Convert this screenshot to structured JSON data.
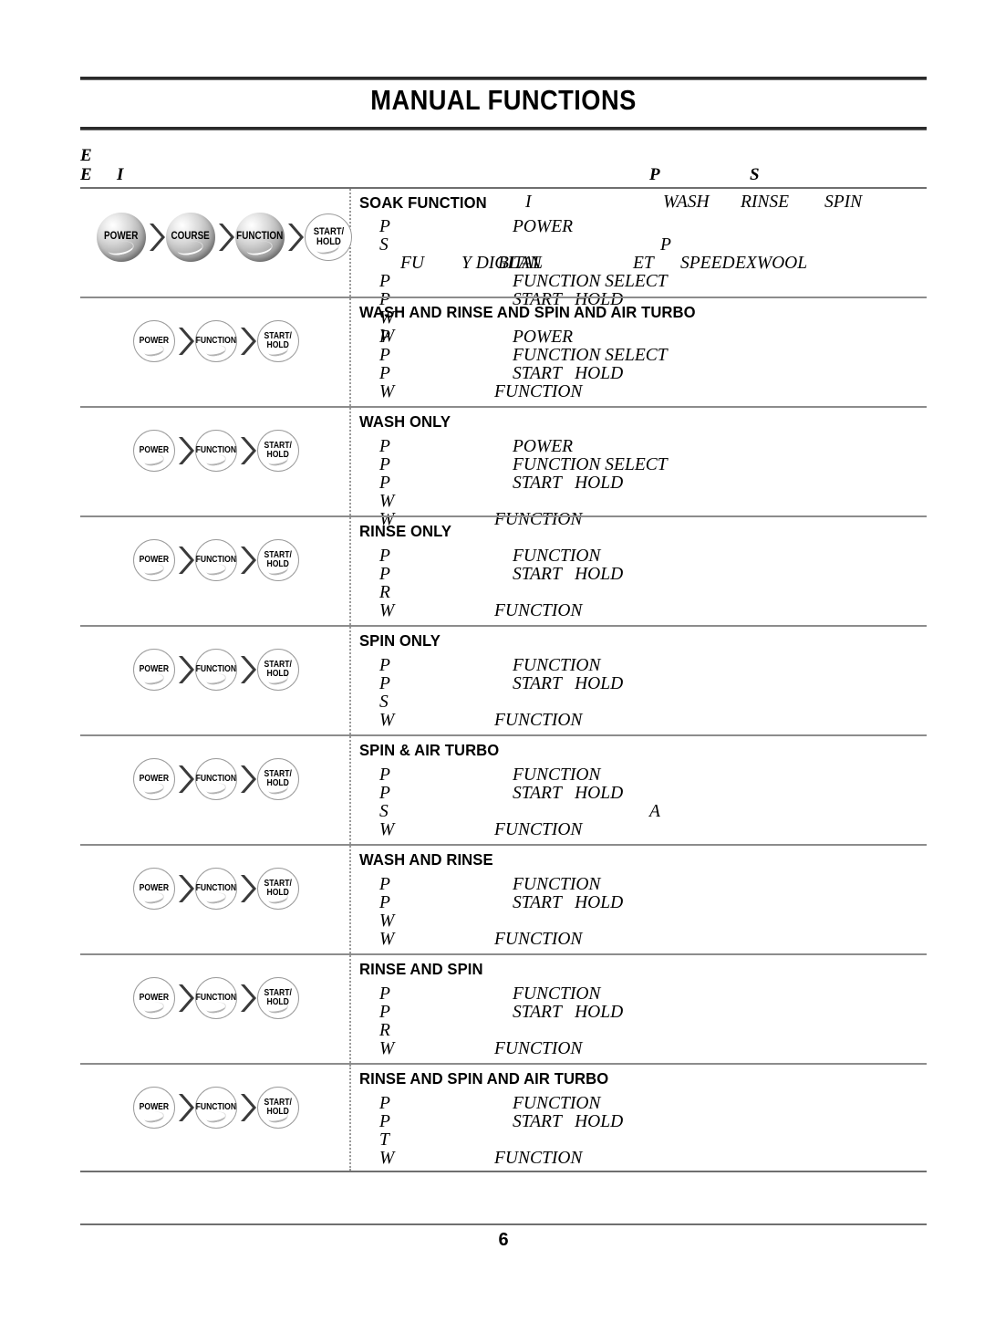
{
  "document": {
    "title": "MANUAL FUNCTIONS",
    "page_number": "6"
  },
  "header_fragments": {
    "line1": "E",
    "line2_a": "E",
    "line2_b": "I",
    "right_p": "P",
    "right_s": "S"
  },
  "buttons": {
    "power": "POWER",
    "course": "COURSE",
    "function": "FUNCTION",
    "start_hold": "START/\nHOLD"
  },
  "rows": [
    {
      "id": "soak-function",
      "title": "SOAK FUNCTION",
      "button_sequence": [
        "POWER",
        "COURSE",
        "FUNCTION",
        "START/HOLD"
      ],
      "button_style": "sphere",
      "title_suffix_I": "I",
      "title_right": [
        "WASH",
        "RINSE",
        "SPIN"
      ],
      "lines": [
        {
          "key": "P",
          "val": "POWER"
        },
        {
          "key": "S",
          "val": "",
          "far": "P"
        },
        {
          "key": "",
          "val": "",
          "course_list": [
            "FU",
            "Y DIGITAL",
            "BLAN",
            "ET",
            "SPEED",
            "EXWOOL"
          ]
        },
        {
          "key": "P",
          "val": "FUNCTION SELECT"
        },
        {
          "key": "P",
          "val": "START   HOLD"
        },
        {
          "key": "W",
          "val": ""
        },
        {
          "key": "W",
          "val": ""
        }
      ]
    },
    {
      "id": "wash-rinse-spin-air-turbo",
      "title": "WASH AND RINSE AND SPIN AND AIR TURBO",
      "button_sequence": [
        "POWER",
        "FUNCTION",
        "START/HOLD"
      ],
      "button_style": "hollow",
      "lines": [
        {
          "key": "P",
          "val": "POWER"
        },
        {
          "key": "P",
          "val": "FUNCTION SELECT"
        },
        {
          "key": "P",
          "val": "START   HOLD"
        },
        {
          "key": "W",
          "val": "FUNCTION",
          "val_left": true
        }
      ]
    },
    {
      "id": "wash-only",
      "title": "WASH ONLY",
      "button_sequence": [
        "POWER",
        "FUNCTION",
        "START/HOLD"
      ],
      "button_style": "hollow",
      "lines": [
        {
          "key": "P",
          "val": "POWER"
        },
        {
          "key": "P",
          "val": "FUNCTION SELECT"
        },
        {
          "key": "P",
          "val": "START   HOLD"
        },
        {
          "key": "W",
          "val": ""
        },
        {
          "key": "W",
          "val": "FUNCTION",
          "val_left": true
        }
      ]
    },
    {
      "id": "rinse-only",
      "title": "RINSE ONLY",
      "button_sequence": [
        "POWER",
        "FUNCTION",
        "START/HOLD"
      ],
      "button_style": "hollow",
      "lines": [
        {
          "key": "P",
          "val": "FUNCTION"
        },
        {
          "key": "P",
          "val": "START   HOLD"
        },
        {
          "key": "R",
          "val": ""
        },
        {
          "key": "W",
          "val": "FUNCTION",
          "val_left": true
        }
      ]
    },
    {
      "id": "spin-only",
      "title": "SPIN ONLY",
      "button_sequence": [
        "POWER",
        "FUNCTION",
        "START/HOLD"
      ],
      "button_style": "hollow",
      "lines": [
        {
          "key": "P",
          "val": "FUNCTION"
        },
        {
          "key": "P",
          "val": "START   HOLD"
        },
        {
          "key": "S",
          "val": ""
        },
        {
          "key": "W",
          "val": "FUNCTION",
          "val_left": true
        }
      ]
    },
    {
      "id": "spin-air-turbo",
      "title": "SPIN & AIR TURBO",
      "button_sequence": [
        "POWER",
        "FUNCTION",
        "START/HOLD"
      ],
      "button_style": "hollow",
      "lines": [
        {
          "key": "P",
          "val": "FUNCTION"
        },
        {
          "key": "P",
          "val": "START   HOLD"
        },
        {
          "key": "S",
          "val": "",
          "far": "A"
        },
        {
          "key": "W",
          "val": "FUNCTION",
          "val_left": true
        }
      ]
    },
    {
      "id": "wash-and-rinse",
      "title": "WASH AND RINSE",
      "button_sequence": [
        "POWER",
        "FUNCTION",
        "START/HOLD"
      ],
      "button_style": "hollow",
      "lines": [
        {
          "key": "P",
          "val": "FUNCTION"
        },
        {
          "key": "P",
          "val": "START   HOLD"
        },
        {
          "key": "W",
          "val": ""
        },
        {
          "key": "W",
          "val": "FUNCTION",
          "val_left": true
        }
      ]
    },
    {
      "id": "rinse-and-spin",
      "title": "RINSE AND SPIN",
      "button_sequence": [
        "POWER",
        "FUNCTION",
        "START/HOLD"
      ],
      "button_style": "hollow",
      "lines": [
        {
          "key": "P",
          "val": "FUNCTION"
        },
        {
          "key": "P",
          "val": "START   HOLD"
        },
        {
          "key": "R",
          "val": ""
        },
        {
          "key": "W",
          "val": "FUNCTION",
          "val_left": true
        }
      ]
    },
    {
      "id": "rinse-spin-air-turbo",
      "title": "RINSE AND SPIN AND AIR TURBO",
      "button_sequence": [
        "POWER",
        "FUNCTION",
        "START/HOLD"
      ],
      "button_style": "hollow",
      "lines": [
        {
          "key": "P",
          "val": "FUNCTION"
        },
        {
          "key": "P",
          "val": "START   HOLD"
        },
        {
          "key": "T",
          "val": ""
        },
        {
          "key": "W",
          "val": "FUNCTION",
          "val_left": true
        }
      ]
    }
  ]
}
